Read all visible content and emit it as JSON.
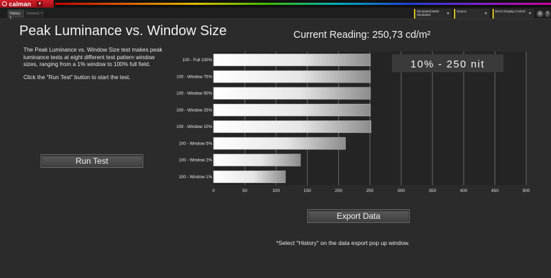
{
  "app": {
    "name": "calman",
    "tabs": [
      {
        "label": "History 1",
        "active": true
      },
      {
        "label": "Kemeck",
        "active": false
      }
    ],
    "dropdowns": [
      {
        "line1": "Simulated Meter",
        "line2": "Simulated"
      },
      {
        "line1": "Source",
        "line2": ""
      },
      {
        "line1": "Direct Display Control",
        "line2": ""
      }
    ]
  },
  "page": {
    "title": "Peak Luminance vs. Window Size",
    "current_reading": "Current Reading: 250,73 cd/m²",
    "description": "The Peak Luminance vs. Window Size test makes peak luminance tests at eight different test pattern window sizes, ranging from a 1% window to 100% full field.",
    "hint": "Click the \"Run Test\" button to start the test.",
    "run_button": "Run Test",
    "export_button": "Export  Data",
    "note": "*Select \"History\" on the data export pop up window."
  },
  "chart_data": {
    "type": "bar",
    "orientation": "horizontal",
    "categories": [
      "100 - Full  100%",
      "100 - Window  75%",
      "100 - Window 50%",
      "100 - Window 25%",
      "100 - Window 10%",
      "100 - Window  5%",
      "100 - Window  2%",
      "100 - Window  1%"
    ],
    "values": [
      251,
      251,
      251,
      251,
      252,
      211,
      139,
      115
    ],
    "xlim": [
      0,
      500
    ],
    "xticks": [
      0,
      50,
      100,
      150,
      200,
      250,
      300,
      350,
      400,
      450,
      500
    ],
    "vertical_grid": true,
    "annotation": "10% - 250 nit",
    "colors": {
      "bar_gradient_start": "#ffffff",
      "bar_gradient_end": "#8c8c8c"
    }
  }
}
